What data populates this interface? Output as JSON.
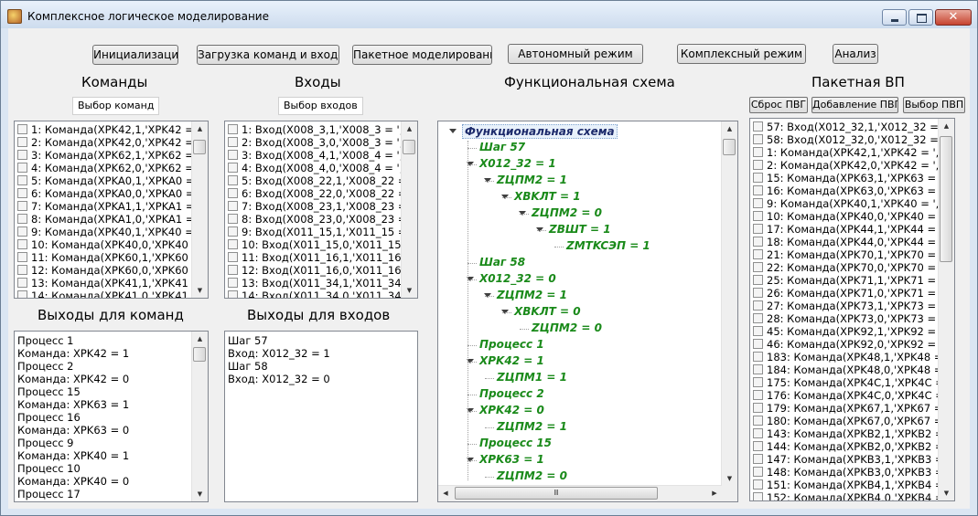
{
  "window": {
    "title": "Комплексное логическое моделирование",
    "min_glyph": "",
    "max_glyph": "",
    "close_glyph": "✕"
  },
  "toolbar": {
    "init": "Инициализация",
    "load": "Загрузка команд и входов",
    "batch": "Пакетное моделирование",
    "auto": "Автономный режим",
    "complex": "Комплексный режим",
    "analysis": "Анализ"
  },
  "commands": {
    "heading": "Команды",
    "select_button": "Выбор команд",
    "items": [
      "1: Команда(XPK42,1,'XPK42 = '",
      "2: Команда(XPK42,0,'XPK42 = '",
      "3: Команда(XPK62,1,'XPK62 = '",
      "4: Команда(XPK62,0,'XPK62 = '",
      "5: Команда(XPKA0,1,'XPKA0 = '",
      "6: Команда(XPKA0,0,'XPKA0 = '",
      "7: Команда(XPKA1,1,'XPKA1 = '",
      "8: Команда(XPKA1,0,'XPKA1 = '",
      "9: Команда(XPK40,1,'XPK40 = '",
      "10: Команда(XPK40,0,'XPK40 = '",
      "11: Команда(XPK60,1,'XPK60 = '",
      "12: Команда(XPK60,0,'XPK60 = '",
      "13: Команда(XPK41,1,'XPK41 = '",
      "14: Команда(XPK41,0,'XPK41 = '"
    ]
  },
  "inputs": {
    "heading": "Входы",
    "select_button": "Выбор входов",
    "items": [
      "1: Вход(X008_3,1,'X008_3 = ',0",
      "2: Вход(X008_3,0,'X008_3 = ',0",
      "3: Вход(X008_4,1,'X008_4 = ',0",
      "4: Вход(X008_4,0,'X008_4 = ',0",
      "5: Вход(X008_22,1,'X008_22 = ",
      "6: Вход(X008_22,0,'X008_22 = ",
      "7: Вход(X008_23,1,'X008_23 = ",
      "8: Вход(X008_23,0,'X008_23 = ",
      "9: Вход(X011_15,1,'X011_15 = ",
      "10: Вход(X011_15,0,'X011_15",
      "11: Вход(X011_16,1,'X011_16",
      "12: Вход(X011_16,0,'X011_16",
      "13: Вход(X011_34,1,'X011_34",
      "14: Вход(X011_34,0,'X011_34"
    ]
  },
  "cmd_outputs": {
    "heading": "Выходы для команд",
    "lines": [
      "Процесс 1",
      "Команда: XPK42 = 1",
      "Процесс 2",
      "Команда: XPK42 = 0",
      "Процесс 15",
      "Команда: XPK63 = 1",
      "Процесс 16",
      "Команда: XPK63 = 0",
      "Процесс 9",
      "Команда: XPK40 = 1",
      "Процесс 10",
      "Команда: XPK40 = 0",
      "Процесс 17"
    ]
  },
  "input_outputs": {
    "heading": "Выходы для входов",
    "lines": [
      "Шаг 57",
      "Вход: X012_32 = 1",
      "Шаг 58",
      "Вход: X012_32 = 0"
    ]
  },
  "scheme": {
    "heading": "Функциональная схема",
    "root": "Функциональная схема",
    "nodes": [
      "Шаг 57",
      "X012_32 = 1",
      "ZЦПМ2 = 1",
      "XBKЛT = 1",
      "ZЦПМ2 = 0",
      "ZBШT = 1",
      "ZMTKCЭП = 1",
      "Шаг 58",
      "X012_32 = 0",
      "ZЦПМ2 = 1",
      "XBKЛT = 0",
      "ZЦПМ2 = 0",
      "Процесс 1",
      "XPK42 = 1",
      "ZЦПМ1 = 1",
      "Процесс 2",
      "XPK42 = 0",
      "ZЦПМ2 = 1",
      "Процесс 15",
      "XPK63 = 1",
      "ZЦПМ2 = 0"
    ],
    "hscroll_grip": "Ⅲ"
  },
  "batch": {
    "heading": "Пакетная ВП",
    "reset_button": "Сброс ПВГ",
    "add_button": "Добавление ПВГ",
    "select_button": "Выбор ПВП",
    "items": [
      "57: Вход(X012_32,1,'X012_32 =",
      "58: Вход(X012_32,0,'X012_32 =",
      "1: Команда(XPK42,1,'XPK42 = ',0",
      "2: Команда(XPK42,0,'XPK42 = ',0",
      "15: Команда(XPK63,1,'XPK63 = ',",
      "16: Команда(XPK63,0,'XPK63 = ',",
      "9: Команда(XPK40,1,'XPK40 = ',0",
      "10: Команда(XPK40,0,'XPK40 = ',",
      "17: Команда(XPK44,1,'XPK44 = ',",
      "18: Команда(XPK44,0,'XPK44 = ',",
      "21: Команда(XPK70,1,'XPK70 = ',",
      "22: Команда(XPK70,0,'XPK70 = ',",
      "25: Команда(XPK71,1,'XPK71 = ',",
      "26: Команда(XPK71,0,'XPK71 = ',",
      "27: Команда(XPK73,1,'XPK73 = ',",
      "28: Команда(XPK73,0,'XPK73 = ',",
      "45: Команда(XPK92,1,'XPK92 = ',",
      "46: Команда(XPK92,0,'XPK92 = ',",
      "183: Команда(XPK48,1,'XPK48 =",
      "184: Команда(XPK48,0,'XPK48 =",
      "175: Команда(XPK4C,1,'XPK4C =",
      "176: Команда(XPK4C,0,'XPK4C =",
      "179: Команда(XPK67,1,'XPK67 =",
      "180: Команда(XPK67,0,'XPK67 =",
      "143: Команда(XPKB2,1,'XPKB2 =",
      "144: Команда(XPKB2,0,'XPKB2 =",
      "147: Команда(XPKB3,1,'XPKB3 =",
      "148: Команда(XPKB3,0,'XPKB3 =",
      "151: Команда(XPKB4,1,'XPKB4 =",
      "152: Команда(XPKB4,0,'XPKB4 ="
    ]
  },
  "scroll_arrows": {
    "up": "▲",
    "down": "▼",
    "left": "◀",
    "right": "▶"
  }
}
